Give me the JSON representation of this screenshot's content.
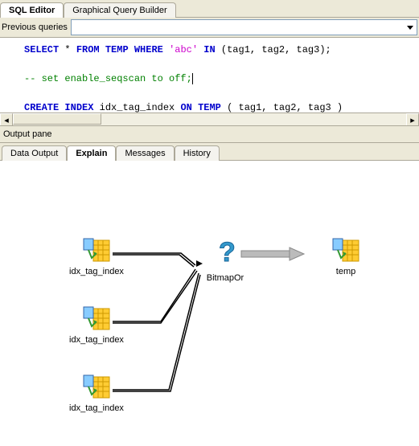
{
  "tabs": {
    "sql_editor": "SQL Editor",
    "graphical": "Graphical Query Builder"
  },
  "prev_label": "Previous queries",
  "sql": {
    "line1": {
      "select": "SELECT",
      "star": "*",
      "from": "FROM",
      "temp": "TEMP",
      "where": "WHERE",
      "str": "'abc'",
      "in": "IN",
      "rest": "(tag1, tag2, tag3);"
    },
    "line2": "-- set enable_seqscan to off;",
    "line3": {
      "create": "CREATE",
      "index_kw": "INDEX",
      "name": "idx_tag_index",
      "on": "ON",
      "temp": "TEMP",
      "rest": "( tag1, tag2, tag3 )"
    }
  },
  "output_label": "Output pane",
  "subtabs": {
    "data_output": "Data Output",
    "explain": "Explain",
    "messages": "Messages",
    "history": "History"
  },
  "plan": {
    "idx1": "idx_tag_index",
    "idx2": "idx_tag_index",
    "idx3": "idx_tag_index",
    "bitmapor": "BitmapOr",
    "temp": "temp"
  }
}
